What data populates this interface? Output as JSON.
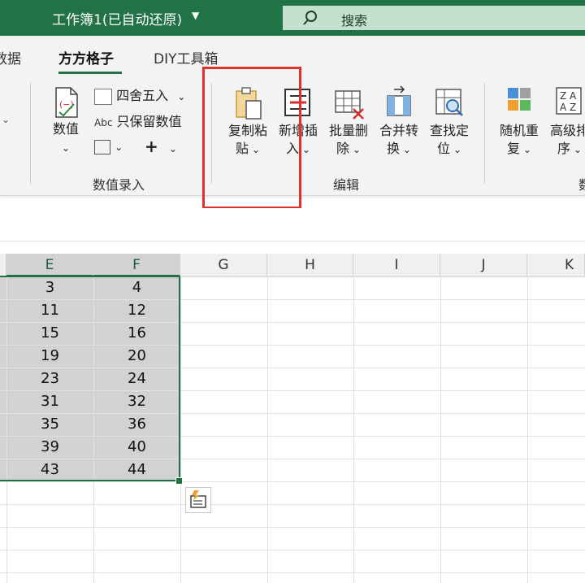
{
  "titlebar": {
    "title": "工作簿1(已自动还原)",
    "search_label": "搜索"
  },
  "tabs": [
    {
      "label": "数据",
      "active": false
    },
    {
      "label": "方方格子",
      "active": true
    },
    {
      "label": "DIY工具箱",
      "active": false
    }
  ],
  "ribbon": {
    "numeric_group": {
      "label": "数值录入",
      "value_button_label": "数值",
      "round_label": "四舍五入",
      "keep_values_label": "只保留数值",
      "abc_text": "Abc",
      "plus_text": "+"
    },
    "edit_group": {
      "label": "编辑",
      "buttons": [
        {
          "line1": "复制粘",
          "line2": "贴"
        },
        {
          "line1": "新增插",
          "line2": "入"
        },
        {
          "line1": "批量删",
          "line2": "除"
        },
        {
          "line1": "合并转",
          "line2": "换"
        },
        {
          "line1": "查找定",
          "line2": "位"
        }
      ]
    },
    "sort_group": {
      "buttons": [
        {
          "line1": "随机重",
          "line2": "复"
        },
        {
          "line1": "高级排",
          "line2": "序"
        }
      ],
      "label_partial": "数"
    }
  },
  "sheet": {
    "columns": [
      "E",
      "F",
      "G",
      "H",
      "I",
      "J",
      "K"
    ],
    "selected_columns": [
      "E",
      "F"
    ],
    "rows": [
      {
        "e": "3",
        "f": "4"
      },
      {
        "e": "11",
        "f": "12"
      },
      {
        "e": "15",
        "f": "16"
      },
      {
        "e": "19",
        "f": "20"
      },
      {
        "e": "23",
        "f": "24"
      },
      {
        "e": "31",
        "f": "32"
      },
      {
        "e": "35",
        "f": "36"
      },
      {
        "e": "39",
        "f": "40"
      },
      {
        "e": "43",
        "f": "44"
      }
    ]
  },
  "colors": {
    "excel_green": "#217346",
    "highlight_red": "#e0312d",
    "selection_fill": "#d2d2d2"
  }
}
